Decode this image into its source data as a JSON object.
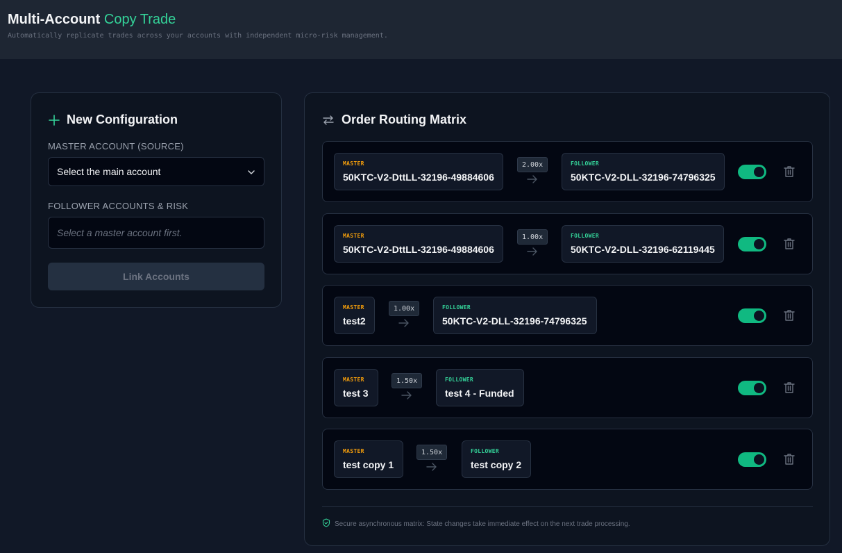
{
  "header": {
    "title_main": "Multi-Account",
    "title_accent": "Copy Trade",
    "subtitle": "Automatically replicate trades across your accounts with independent micro-risk management."
  },
  "new_config": {
    "heading": "New Configuration",
    "master_label": "MASTER ACCOUNT (SOURCE)",
    "master_select_value": "Select the main account",
    "follower_label": "FOLLOWER ACCOUNTS & RISK",
    "follower_placeholder": "Select a master account first.",
    "link_button": "Link Accounts"
  },
  "matrix": {
    "heading": "Order Routing Matrix",
    "routes": [
      {
        "master_role": "MASTER",
        "master": "50KTC-V2-DttLL-32196-49884606",
        "multiplier": "2.00x",
        "follower_role": "FOLLOWER",
        "follower": "50KTC-V2-DLL-32196-74796325",
        "enabled": true
      },
      {
        "master_role": "MASTER",
        "master": "50KTC-V2-DttLL-32196-49884606",
        "multiplier": "1.00x",
        "follower_role": "FOLLOWER",
        "follower": "50KTC-V2-DLL-32196-62119445",
        "enabled": true
      },
      {
        "master_role": "MASTER",
        "master": "test2",
        "multiplier": "1.00x",
        "follower_role": "FOLLOWER",
        "follower": "50KTC-V2-DLL-32196-74796325",
        "enabled": true
      },
      {
        "master_role": "MASTER",
        "master": "test 3",
        "multiplier": "1.50x",
        "follower_role": "FOLLOWER",
        "follower": "test 4 - Funded",
        "enabled": true
      },
      {
        "master_role": "MASTER",
        "master": "test copy 1",
        "multiplier": "1.50x",
        "follower_role": "FOLLOWER",
        "follower": "test copy 2",
        "enabled": true
      }
    ],
    "footnote": "Secure asynchronous matrix: State changes take immediate effect on the next trade processing."
  },
  "colors": {
    "accent": "#34d399",
    "master_role": "#f59e0b",
    "toggle_on": "#10b981"
  }
}
